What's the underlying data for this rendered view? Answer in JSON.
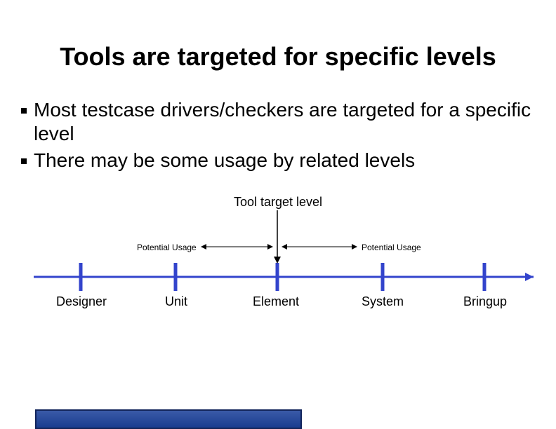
{
  "title": "Tools are targeted for specific levels",
  "bullets": [
    "Most testcase drivers/checkers are targeted for a specific\nlevel",
    "There may be some usage by related levels"
  ],
  "diagram": {
    "target_label": "Tool target level",
    "usage_left": "Potential Usage",
    "usage_right": "Potential Usage"
  },
  "axis": {
    "labels": [
      "Designer",
      "Unit",
      "Element",
      "System",
      "Bringup"
    ]
  },
  "chart_data": {
    "type": "line",
    "title": "Tool target level",
    "categories": [
      "Designer",
      "Unit",
      "Element",
      "System",
      "Bringup"
    ],
    "target_index": 2,
    "potential_usage_range": [
      1,
      3
    ],
    "xlabel": "",
    "ylabel": ""
  },
  "colors": {
    "axis_blue": "#3344cc",
    "accent": "#1a3d8f"
  }
}
